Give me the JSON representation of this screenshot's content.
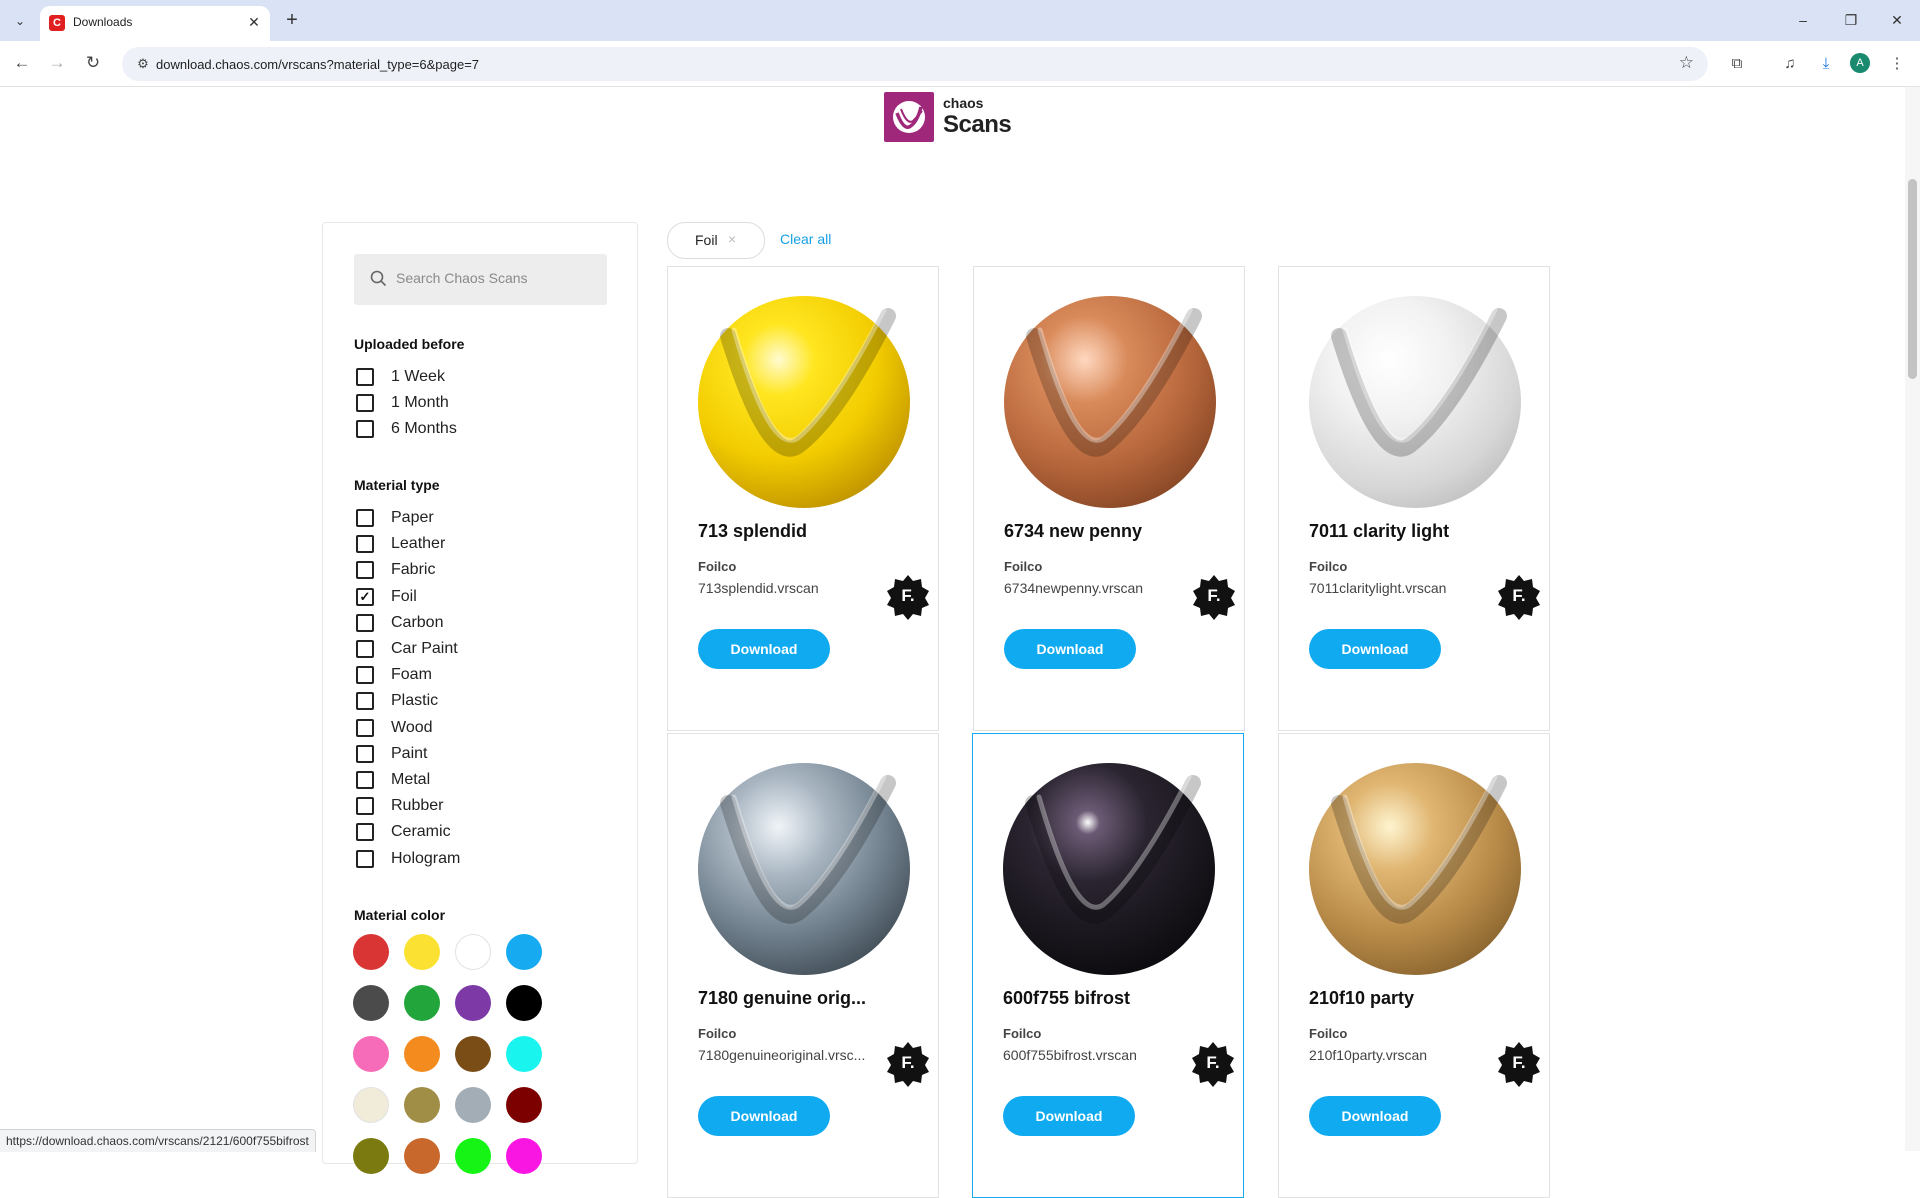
{
  "browser": {
    "tab_title": "Downloads",
    "url": "download.chaos.com/vrscans?material_type=6&page=7",
    "status_url": "https://download.chaos.com/vrscans/2121/600f755bifrost",
    "profile_initial": "A"
  },
  "logo": {
    "small": "chaos",
    "big": "Scans"
  },
  "sidebar": {
    "search_placeholder": "Search Chaos Scans",
    "uploaded_before": {
      "title": "Uploaded before",
      "options": [
        {
          "label": "1 Week",
          "checked": false
        },
        {
          "label": "1 Month",
          "checked": false
        },
        {
          "label": "6 Months",
          "checked": false
        }
      ]
    },
    "material_type": {
      "title": "Material type",
      "options": [
        {
          "label": "Paper",
          "checked": false
        },
        {
          "label": "Leather",
          "checked": false
        },
        {
          "label": "Fabric",
          "checked": false
        },
        {
          "label": "Foil",
          "checked": true
        },
        {
          "label": "Carbon",
          "checked": false
        },
        {
          "label": "Car Paint",
          "checked": false
        },
        {
          "label": "Foam",
          "checked": false
        },
        {
          "label": "Plastic",
          "checked": false
        },
        {
          "label": "Wood",
          "checked": false
        },
        {
          "label": "Paint",
          "checked": false
        },
        {
          "label": "Metal",
          "checked": false
        },
        {
          "label": "Rubber",
          "checked": false
        },
        {
          "label": "Ceramic",
          "checked": false
        },
        {
          "label": "Hologram",
          "checked": false
        }
      ]
    },
    "material_color": {
      "title": "Material color",
      "swatches": [
        "#d93535",
        "#fbe232",
        "#ffffff",
        "#16aaf0",
        "#4b4b4b",
        "#22a63c",
        "#7d3aa6",
        "#000000",
        "#f76cb8",
        "#f48b1e",
        "#7a4c16",
        "#19f4ee",
        "#f1ebd9",
        "#a08e47",
        "#a3adb5",
        "#7d0000",
        "#7b7a10",
        "#c9682d",
        "#16f416",
        "#f916e2"
      ]
    }
  },
  "active_filter": {
    "chip": "Foil",
    "chip_close": "×",
    "clear_all": "Clear all"
  },
  "cards": [
    {
      "title": "713 splendid",
      "brand": "Foilco",
      "file": "713splendid.vrscan",
      "button": "Download",
      "badge": "F."
    },
    {
      "title": "6734 new penny",
      "brand": "Foilco",
      "file": "6734newpenny.vrscan",
      "button": "Download",
      "badge": "F."
    },
    {
      "title": "7011 clarity light",
      "brand": "Foilco",
      "file": "7011claritylight.vrscan",
      "button": "Download",
      "badge": "F."
    },
    {
      "title": "7180 genuine orig...",
      "brand": "Foilco",
      "file": "7180genuineoriginal.vrsc...",
      "button": "Download",
      "badge": "F."
    },
    {
      "title": "600f755 bifrost",
      "brand": "Foilco",
      "file": "600f755bifrost.vrscan",
      "button": "Download",
      "badge": "F."
    },
    {
      "title": "210f10 party",
      "brand": "Foilco",
      "file": "210f10party.vrscan",
      "button": "Download",
      "badge": "F."
    }
  ]
}
